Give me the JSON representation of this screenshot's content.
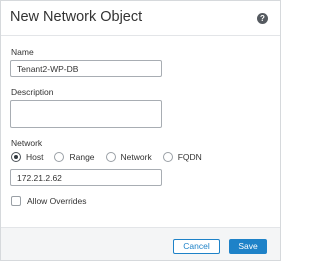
{
  "dialog": {
    "title": "New Network Object",
    "help_icon": "question-circle-icon",
    "help_glyph": "?"
  },
  "name_field": {
    "label": "Name",
    "value": "Tenant2-WP-DB"
  },
  "description_field": {
    "label": "Description",
    "value": ""
  },
  "network": {
    "label": "Network",
    "options": [
      "Host",
      "Range",
      "Network",
      "FQDN"
    ],
    "selected": "Host",
    "value": "172.21.2.62"
  },
  "allow_overrides": {
    "label": "Allow Overrides",
    "checked": false
  },
  "footer": {
    "cancel_label": "Cancel",
    "save_label": "Save"
  },
  "colors": {
    "accent": "#1e82c8",
    "text": "#333333",
    "border": "#a8adb3",
    "footer_bg": "#f4f5f6"
  }
}
